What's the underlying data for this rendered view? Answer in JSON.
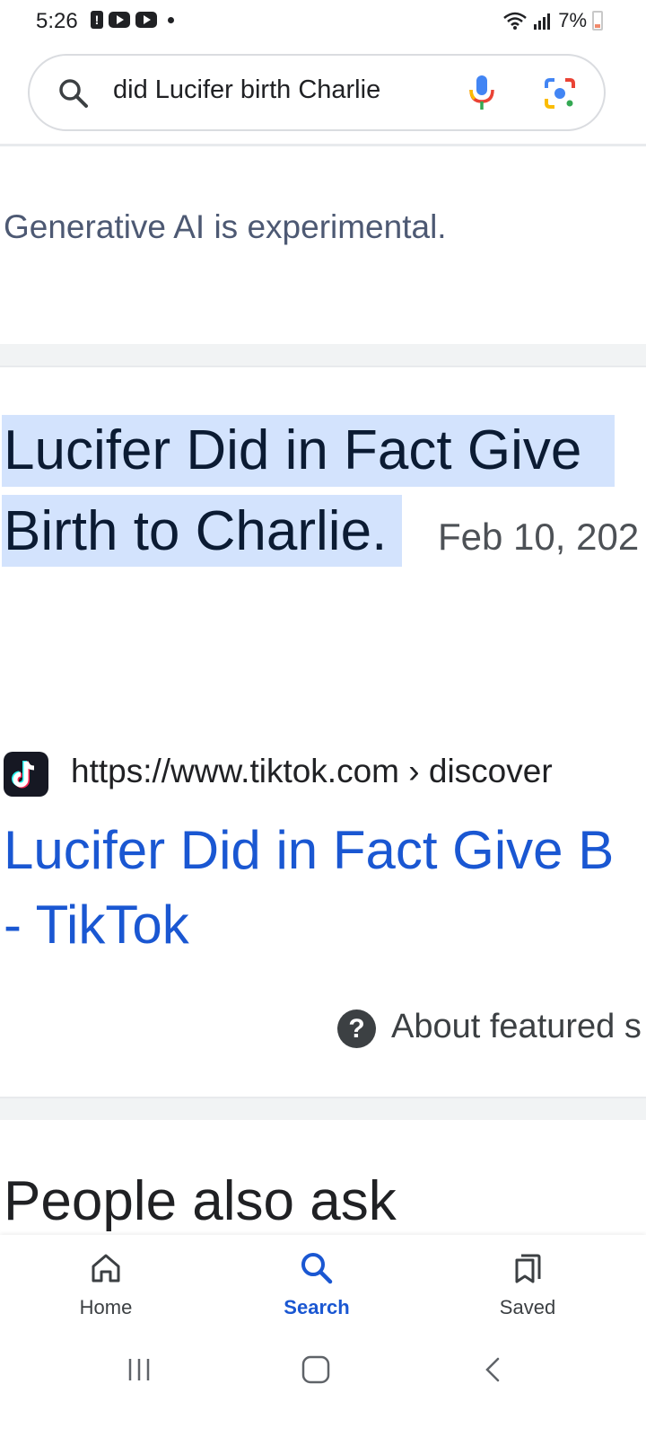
{
  "status_bar": {
    "time": "5:26",
    "notification_glyph": "!",
    "battery": "7%"
  },
  "search": {
    "query": "did Lucifer birth Charlie"
  },
  "ai_notice": "Generative AI is experimental.",
  "featured_snippet": {
    "line1": "Lucifer Did in Fact Give",
    "line2_highlighted": "Birth to Charlie",
    "line2_suffix": ".",
    "date": "Feb 10, 202"
  },
  "result": {
    "url": "https://www.tiktok.com › discover",
    "title_line1": "Lucifer Did in Fact Give B",
    "title_line2": "- TikTok",
    "help_glyph": "?",
    "about_label": "About featured s"
  },
  "people_also_ask": "People also ask",
  "bottom_nav": {
    "items": [
      {
        "label": "Home",
        "icon": "home-icon"
      },
      {
        "label": "Search",
        "icon": "search-icon",
        "active": true
      },
      {
        "label": "Saved",
        "icon": "saved-icon"
      }
    ]
  },
  "colors": {
    "accent_blue": "#1a57d2",
    "highlight": "#d3e3fd",
    "tiktok_bg": "#161823"
  }
}
